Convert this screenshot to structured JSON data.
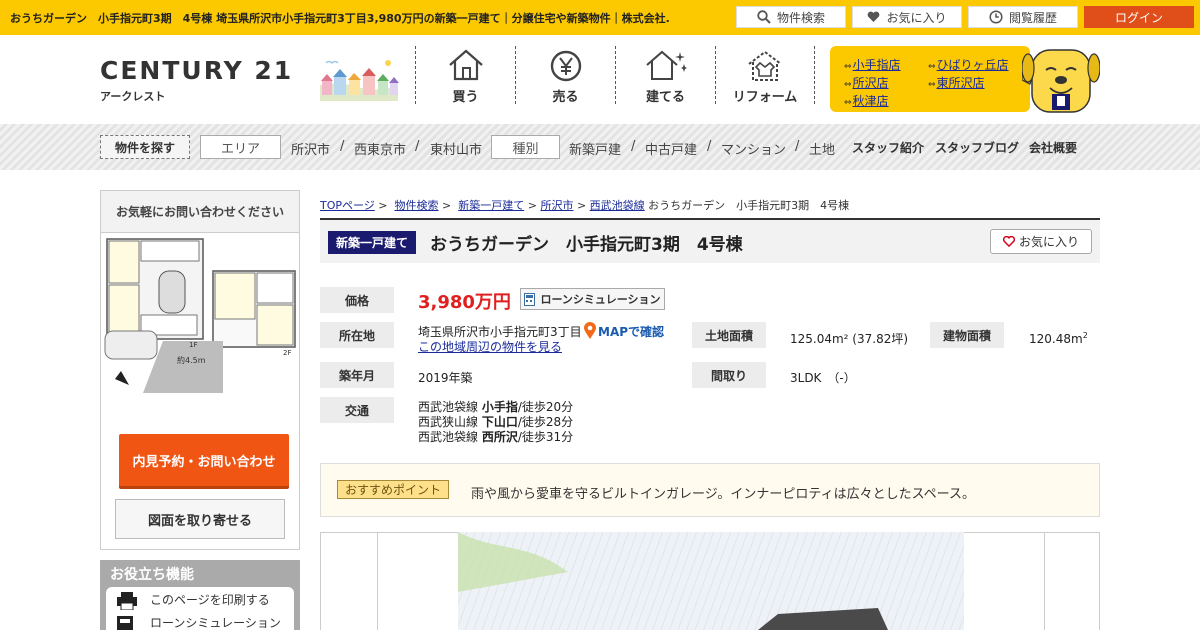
{
  "topbar": {
    "title": "おうちガーデン　小手指元町3期　4号棟 埼玉県所沢市小手指元町3丁目3,980万円の新築一戸建て｜分譲住宅や新築物件｜株式会社...",
    "search_label": "物件検索",
    "favorites_label": "お気に入り",
    "history_label": "閲覧履歴",
    "login_label": "ログイン"
  },
  "header": {
    "brand": "CENTURY 21",
    "subbrand": "アークレスト",
    "nav": [
      {
        "label": "買う",
        "icon": "house-icon"
      },
      {
        "label": "売る",
        "icon": "yen-icon"
      },
      {
        "label": "建てる",
        "icon": "sparkle-house-icon"
      },
      {
        "label": "リフォーム",
        "icon": "tshirt-house-icon"
      }
    ],
    "shops": [
      "小手指店",
      "ひばりヶ丘店",
      "所沢店",
      "東所沢店",
      "秋津店"
    ]
  },
  "catbar": {
    "find_label": "物件を探す",
    "area_label": "エリア",
    "areas": [
      "所沢市",
      "西東京市",
      "東村山市"
    ],
    "type_label": "種別",
    "types": [
      "新築戸建",
      "中古戸建",
      "マンション",
      "土地"
    ],
    "links": [
      "スタッフ紹介",
      "スタッフブログ",
      "会社概要"
    ],
    "separator": "/"
  },
  "sidebar": {
    "heading": "お気軽にお問い合わせください",
    "contact_button": "内見予約・お問い合わせ",
    "plan_button": "図面を取り寄せる",
    "floorplan": {
      "floor1": "1F",
      "floor2": "2F",
      "distance": "約4.5m"
    },
    "tools_heading": "お役立ち機能",
    "tools": [
      "このページを印刷する",
      "ローンシミュレーション"
    ]
  },
  "breadcrumb": {
    "items": [
      "TOPページ",
      "物件検索",
      "新築一戸建て",
      "所沢市",
      "西武池袋線"
    ],
    "current": "おうちガーデン　小手指元町3期　4号棟",
    "sep": ">"
  },
  "property": {
    "badge": "新築一戸建て",
    "title": "おうちガーデン　小手指元町3期　4号棟",
    "favorite_button": "お気に入り",
    "price_label": "価格",
    "price": "3,980万円",
    "loan_button": "ローンシミュレーション",
    "address_label": "所在地",
    "address": "埼玉県所沢市小手指元町3丁目",
    "map_link": "MAPで確認",
    "nearby_link": "この地域周辺の物件を見る",
    "land_label": "土地面積",
    "land_area": "125.04m² (37.82坪)",
    "building_label": "建物面積",
    "building_area": "120.48m",
    "building_unit_sup": "2",
    "built_label": "築年月",
    "built": "2019年築",
    "layout_label": "間取り",
    "layout": "3LDK　（-）",
    "access_label": "交通",
    "access": [
      {
        "line": "西武池袋線",
        "station": "小手指",
        "walk": "/徒歩20分"
      },
      {
        "line": "西武狭山線",
        "station": "下山口",
        "walk": "/徒歩28分"
      },
      {
        "line": "西武池袋線",
        "station": "西所沢",
        "walk": "/徒歩31分"
      }
    ],
    "point_tag": "おすすめポイント",
    "point_text": "雨や風から愛車を守るビルトインガレージ。インナーピロティは広々としたスペース。"
  },
  "colors": {
    "brand_yellow": "#fcc800",
    "login_red": "#e04e1a",
    "cta_orange": "#f05514",
    "price_red": "#e02020",
    "badge_navy": "#1a1a6e"
  }
}
